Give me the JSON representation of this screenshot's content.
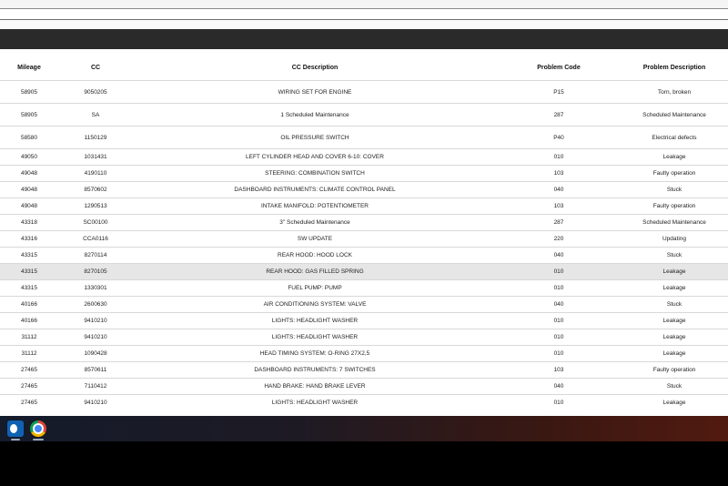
{
  "table": {
    "headers": [
      "Mileage",
      "CC",
      "CC Description",
      "Problem Code",
      "Problem Description"
    ],
    "rows": [
      {
        "mileage": "58905",
        "cc": "9050205",
        "desc": "WIRING SET FOR ENGINE",
        "code": "P15",
        "problem": "Torn, broken"
      },
      {
        "mileage": "58905",
        "cc": "SA",
        "desc": "1 Scheduled Maintenance",
        "code": "287",
        "problem": "Scheduled Maintenance"
      },
      {
        "mileage": "58580",
        "cc": "1150129",
        "desc": "OIL PRESSURE SWITCH",
        "code": "P40",
        "problem": "Electrical defects"
      },
      {
        "mileage": "49050",
        "cc": "1031431",
        "desc": "LEFT CYLINDER HEAD AND COVER 6-10: COVER",
        "code": "010",
        "problem": "Leakage"
      },
      {
        "mileage": "49048",
        "cc": "4190110",
        "desc": "STEERING: COMBINATION SWITCH",
        "code": "103",
        "problem": "Faulty operation"
      },
      {
        "mileage": "49048",
        "cc": "8570602",
        "desc": "DASHBOARD INSTRUMENTS: CLIMATE CONTROL PANEL",
        "code": "040",
        "problem": "Stuck"
      },
      {
        "mileage": "49048",
        "cc": "1290513",
        "desc": "INTAKE MANIFOLD: POTENTIOMETER",
        "code": "103",
        "problem": "Faulty operation"
      },
      {
        "mileage": "43318",
        "cc": "SC00100",
        "desc": "3\" Scheduled Maintenance",
        "code": "287",
        "problem": "Scheduled Maintenance"
      },
      {
        "mileage": "43316",
        "cc": "CCA0116",
        "desc": "SW UPDATE",
        "code": "220",
        "problem": "Updating"
      },
      {
        "mileage": "43315",
        "cc": "8270114",
        "desc": "REAR HOOD: HOOD LOCK",
        "code": "040",
        "problem": "Stuck"
      },
      {
        "mileage": "43315",
        "cc": "8270105",
        "desc": "REAR HOOD: GAS FILLED SPRING",
        "code": "010",
        "problem": "Leakage"
      },
      {
        "mileage": "43315",
        "cc": "1330301",
        "desc": "FUEL PUMP: PUMP",
        "code": "010",
        "problem": "Leakage"
      },
      {
        "mileage": "40166",
        "cc": "2600630",
        "desc": "AIR CONDITIONING SYSTEM: VALVE",
        "code": "040",
        "problem": "Stuck"
      },
      {
        "mileage": "40166",
        "cc": "9410210",
        "desc": "LIGHTS: HEADLIGHT WASHER",
        "code": "010",
        "problem": "Leakage"
      },
      {
        "mileage": "31112",
        "cc": "9410210",
        "desc": "LIGHTS: HEADLIGHT WASHER",
        "code": "010",
        "problem": "Leakage"
      },
      {
        "mileage": "31112",
        "cc": "1090428",
        "desc": "HEAD TIMING SYSTEM: O-RING 27X2,5",
        "code": "010",
        "problem": "Leakage"
      },
      {
        "mileage": "27465",
        "cc": "8570611",
        "desc": "DASHBOARD INSTRUMENTS: 7 SWITCHES",
        "code": "103",
        "problem": "Faulty operation"
      },
      {
        "mileage": "27465",
        "cc": "7110412",
        "desc": "HAND BRAKE: HAND BRAKE LEVER",
        "code": "040",
        "problem": "Stuck"
      },
      {
        "mileage": "27465",
        "cc": "9410210",
        "desc": "LIGHTS: HEADLIGHT WASHER",
        "code": "010",
        "problem": "Leakage"
      }
    ]
  },
  "taskbar": {
    "apps": [
      {
        "icon": "outlook-icon"
      },
      {
        "icon": "chrome-icon"
      }
    ]
  },
  "colors": {
    "header_band": "#2a2a2a",
    "row_highlight": "#e6e6e6",
    "row_border": "#d8d8d8"
  }
}
